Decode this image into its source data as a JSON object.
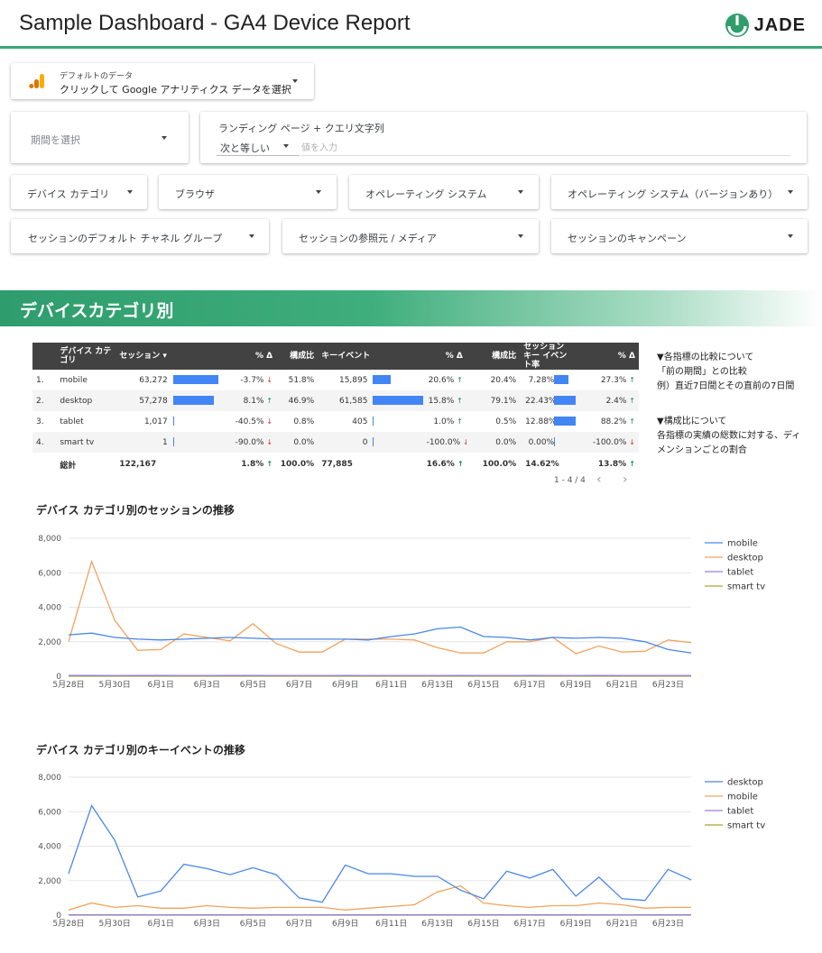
{
  "header": {
    "title": "Sample Dashboard - GA4 Device Report",
    "logo_text": "JADE"
  },
  "datasource": {
    "label": "デフォルトのデータ",
    "value": "クリックして Google アナリティクス データを選択"
  },
  "controls": {
    "date_range": "期間を選択",
    "landing": {
      "label": "ランディング ページ + クエリ文字列",
      "operator": "次と等しい",
      "placeholder": "値を入力"
    },
    "filters_row1": [
      "デバイス カテゴリ",
      "ブラウザ",
      "オペレーティング システム",
      "オペレーティング システム（バージョンあり）"
    ],
    "filters_row2": [
      "セッションのデフォルト チャネル グループ",
      "セッションの参照元 / メディア",
      "セッションのキャンペーン"
    ]
  },
  "section_title": "デバイスカテゴリ別",
  "table": {
    "headers": [
      "デバイス カテゴリ",
      "セッション ▾",
      "% Δ",
      "構成比",
      "キーイベント",
      "% Δ",
      "構成比",
      "セッション キー イベント率",
      "% Δ"
    ],
    "rows": [
      {
        "idx": "1.",
        "device": "mobile",
        "sessions": "63,272",
        "s_bar": 1.0,
        "s_delta": "-3.7%",
        "s_dir": "down",
        "s_share": "51.8%",
        "events": "15,895",
        "e_bar": 0.26,
        "e_delta": "20.6%",
        "e_dir": "up",
        "e_share": "20.4%",
        "rate": "7.28%",
        "r_bar": 0.32,
        "r_delta": "27.3%",
        "r_dir": "up"
      },
      {
        "idx": "2.",
        "device": "desktop",
        "sessions": "57,278",
        "s_bar": 0.905,
        "s_delta": "8.1%",
        "s_dir": "up",
        "s_share": "46.9%",
        "events": "61,585",
        "e_bar": 1.0,
        "e_delta": "15.8%",
        "e_dir": "up",
        "e_share": "79.1%",
        "rate": "22.43%",
        "r_bar": 1.0,
        "r_delta": "2.4%",
        "r_dir": "up"
      },
      {
        "idx": "3.",
        "device": "tablet",
        "sessions": "1,017",
        "s_bar": 0.016,
        "s_delta": "-40.5%",
        "s_dir": "down",
        "s_share": "0.8%",
        "events": "405",
        "e_bar": 0.007,
        "e_delta": "1.0%",
        "e_dir": "up",
        "e_share": "0.5%",
        "rate": "12.88%",
        "r_bar": 0.57,
        "r_delta": "88.2%",
        "r_dir": "up"
      },
      {
        "idx": "4.",
        "device": "smart tv",
        "sessions": "1",
        "s_bar": 0.0,
        "s_delta": "-90.0%",
        "s_dir": "down",
        "s_share": "0.0%",
        "events": "0",
        "e_bar": 0.0,
        "e_delta": "-100.0%",
        "e_dir": "down",
        "e_share": "0.0%",
        "rate": "0.00%",
        "r_bar": 0.0,
        "r_delta": "-100.0%",
        "r_dir": "down"
      }
    ],
    "total": {
      "label": "総計",
      "sessions": "122,167",
      "s_delta": "1.8%",
      "s_share": "100.0%",
      "events": "77,885",
      "e_delta": "16.6%",
      "e_share": "100.0%",
      "rate": "14.62%",
      "r_delta": "13.8%"
    },
    "pager": "1 - 4 / 4"
  },
  "notes": {
    "comparison": [
      "▼各指標の比較について",
      "「前の期間」との比較",
      "例）直近7日間とその直前の7日間"
    ],
    "share": [
      "▼構成比について",
      "各指標の実績の総数に対する、ディ",
      "メンションごとの割合"
    ]
  },
  "chart_data": [
    {
      "type": "line",
      "title": "デバイス カテゴリ別のセッションの推移",
      "x": [
        "5月28日",
        "5月29日",
        "5月30日",
        "5月31日",
        "6月1日",
        "6月2日",
        "6月3日",
        "6月4日",
        "6月5日",
        "6月6日",
        "6月7日",
        "6月8日",
        "6月9日",
        "6月10日",
        "6月11日",
        "6月12日",
        "6月13日",
        "6月14日",
        "6月15日",
        "6月16日",
        "6月17日",
        "6月18日",
        "6月19日",
        "6月20日",
        "6月21日",
        "6月22日",
        "6月23日",
        "6月24日"
      ],
      "x_tick_labels": [
        "5月28日",
        "5月30日",
        "6月1日",
        "6月3日",
        "6月5日",
        "6月7日",
        "6月9日",
        "6月11日",
        "6月13日",
        "6月15日",
        "6月17日",
        "6月19日",
        "6月21日",
        "6月23日"
      ],
      "ylim": [
        0,
        8000
      ],
      "y_ticks": [
        "0",
        "2,000",
        "4,000",
        "6,000",
        "8,000"
      ],
      "legend_position": "right",
      "series": [
        {
          "name": "mobile",
          "color": "#4a86e8",
          "values": [
            2400,
            2500,
            2250,
            2150,
            2100,
            2150,
            2200,
            2250,
            2200,
            2150,
            2150,
            2150,
            2150,
            2100,
            2300,
            2450,
            2750,
            2850,
            2300,
            2250,
            2100,
            2250,
            2200,
            2250,
            2200,
            2000,
            1550,
            1350
          ]
        },
        {
          "name": "desktop",
          "color": "#f0a35e",
          "values": [
            2000,
            6650,
            3250,
            1500,
            1550,
            2450,
            2250,
            2050,
            3050,
            1900,
            1400,
            1400,
            2150,
            2150,
            2150,
            2100,
            1650,
            1350,
            1350,
            2000,
            2000,
            2250,
            1300,
            1750,
            1400,
            1450,
            2100,
            1950
          ]
        },
        {
          "name": "tablet",
          "color": "#9e7de0",
          "values": [
            45,
            40,
            38,
            42,
            40,
            38,
            35,
            40,
            42,
            38,
            36,
            38,
            40,
            38,
            36,
            35,
            38,
            40,
            36,
            38,
            40,
            36,
            38,
            40,
            36,
            38,
            34,
            35
          ]
        },
        {
          "name": "smart tv",
          "color": "#a8a832",
          "values": [
            0,
            0,
            0,
            0,
            0,
            0,
            0,
            0,
            0,
            0,
            0,
            0,
            0,
            0,
            0,
            0,
            0,
            0,
            0,
            0,
            0,
            0,
            0,
            0,
            0,
            0,
            0,
            0
          ]
        }
      ]
    },
    {
      "type": "line",
      "title": "デバイス カテゴリ別のキーイベントの推移",
      "x": [
        "5月28日",
        "5月29日",
        "5月30日",
        "5月31日",
        "6月1日",
        "6月2日",
        "6月3日",
        "6月4日",
        "6月5日",
        "6月6日",
        "6月7日",
        "6月8日",
        "6月9日",
        "6月10日",
        "6月11日",
        "6月12日",
        "6月13日",
        "6月14日",
        "6月15日",
        "6月16日",
        "6月17日",
        "6月18日",
        "6月19日",
        "6月20日",
        "6月21日",
        "6月22日",
        "6月23日",
        "6月24日"
      ],
      "x_tick_labels": [
        "5月28日",
        "5月30日",
        "6月1日",
        "6月3日",
        "6月5日",
        "6月7日",
        "6月9日",
        "6月11日",
        "6月13日",
        "6月15日",
        "6月17日",
        "6月19日",
        "6月21日",
        "6月23日"
      ],
      "ylim": [
        0,
        8000
      ],
      "y_ticks": [
        "0",
        "2,000",
        "4,000",
        "6,000",
        "8,000"
      ],
      "legend_position": "right",
      "series": [
        {
          "name": "desktop",
          "color": "#4a86e8",
          "values": [
            2400,
            6350,
            4350,
            1050,
            1400,
            2950,
            2700,
            2350,
            2750,
            2350,
            1000,
            750,
            2900,
            2400,
            2400,
            2250,
            2250,
            1450,
            950,
            2550,
            2150,
            2650,
            1100,
            2200,
            950,
            850,
            2650,
            2050
          ]
        },
        {
          "name": "mobile",
          "color": "#f0a35e",
          "values": [
            300,
            700,
            450,
            550,
            400,
            400,
            550,
            450,
            400,
            450,
            450,
            450,
            300,
            400,
            500,
            600,
            1350,
            1700,
            700,
            550,
            450,
            550,
            550,
            700,
            600,
            400,
            450,
            450
          ]
        },
        {
          "name": "tablet",
          "color": "#9e7de0",
          "values": [
            15,
            20,
            18,
            15,
            12,
            15,
            18,
            14,
            15,
            16,
            12,
            14,
            15,
            18,
            15,
            14,
            16,
            15,
            14,
            15,
            16,
            14,
            15,
            14,
            12,
            15,
            14,
            15
          ]
        },
        {
          "name": "smart tv",
          "color": "#a8a832",
          "values": [
            0,
            0,
            0,
            0,
            0,
            0,
            0,
            0,
            0,
            0,
            0,
            0,
            0,
            0,
            0,
            0,
            0,
            0,
            0,
            0,
            0,
            0,
            0,
            0,
            0,
            0,
            0,
            0
          ]
        }
      ]
    }
  ]
}
